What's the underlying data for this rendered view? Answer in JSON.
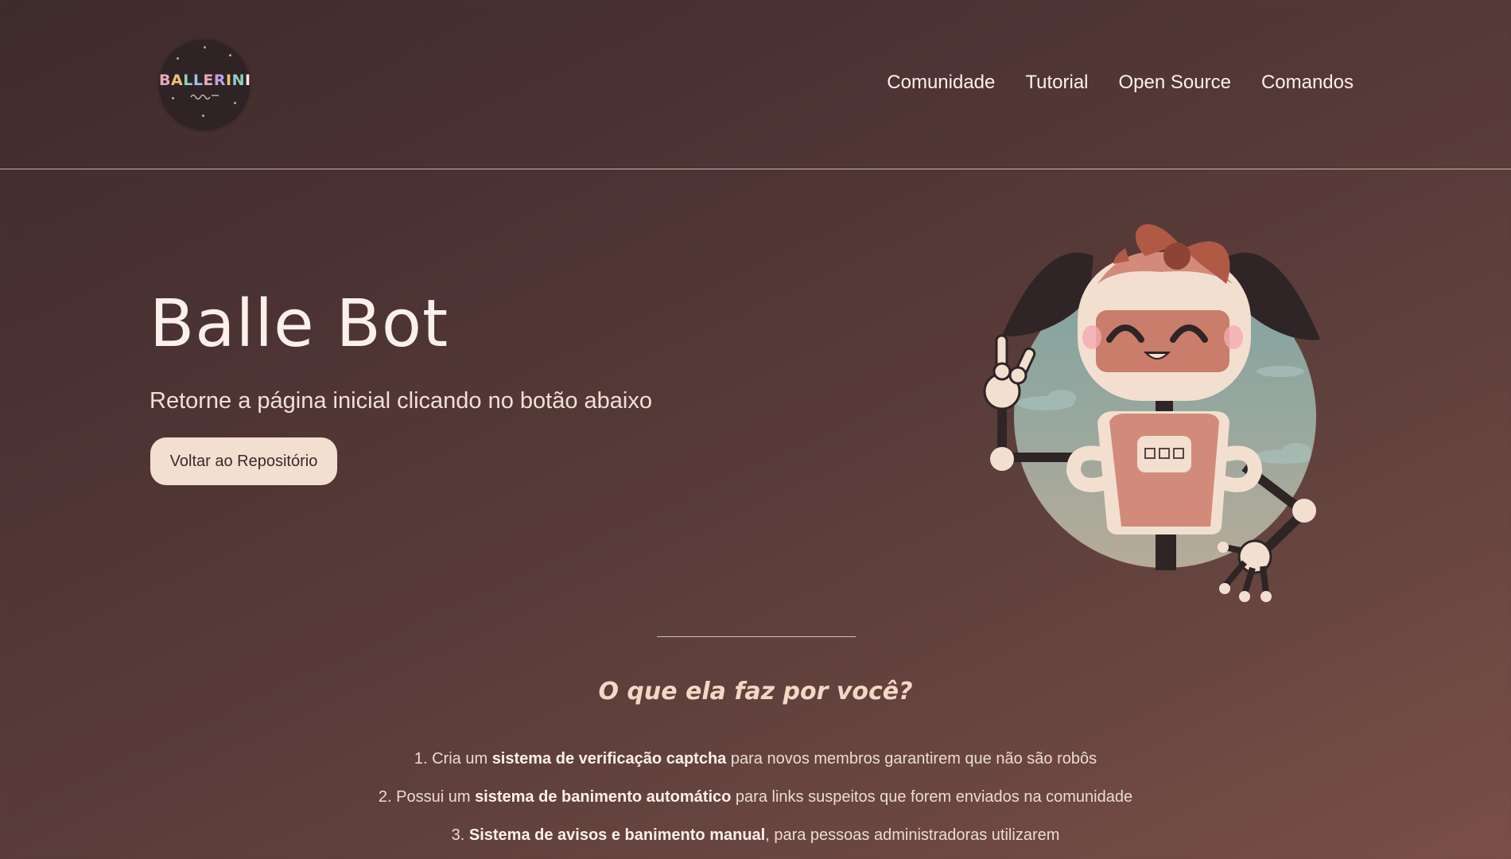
{
  "header": {
    "logo_text": "BALLERINI",
    "nav": [
      "Comunidade",
      "Tutorial",
      "Open Source",
      "Comandos"
    ]
  },
  "hero": {
    "title": "Balle Bot",
    "subtitle": "Retorne a página inicial clicando no botão abaixo",
    "button_label": "Voltar ao Repositório"
  },
  "features": {
    "title": "O que ela faz por você?",
    "items": [
      {
        "num": "1.",
        "pre": "Cria um",
        "bold": "sistema de verificação captcha",
        "post": "para novos membros garantirem que não são robôs"
      },
      {
        "num": "2.",
        "pre": "Possui um",
        "bold": "sistema de banimento automático",
        "post": "para links suspeitos que forem enviados na comunidade"
      },
      {
        "num": "3.",
        "pre": "",
        "bold": "Sistema de avisos e banimento manual",
        "post": ", para pessoas administradoras utilizarem"
      }
    ]
  },
  "colors": {
    "background_start": "#3e2b2c",
    "background_end": "#7a4f47",
    "button_bg": "#f3dfd0",
    "accent_robot": "#c97d6a",
    "section_title": "#f3d8c6"
  }
}
